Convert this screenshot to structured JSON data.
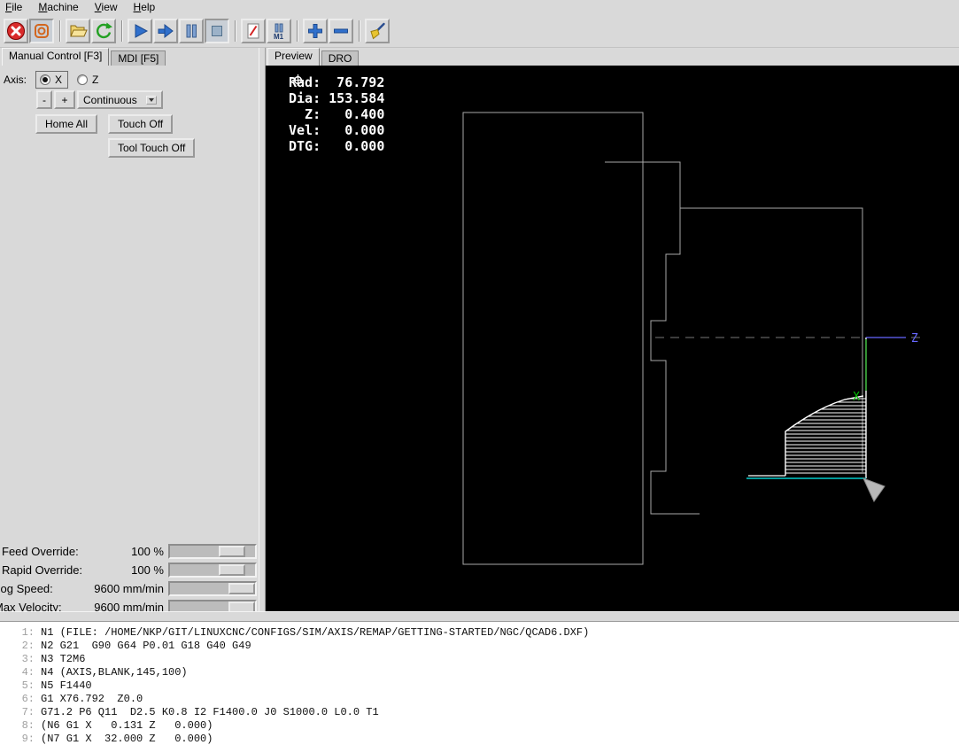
{
  "menu": {
    "items": [
      "File",
      "Machine",
      "View",
      "Help"
    ]
  },
  "toolbar": {
    "optional_pause_label": "M1",
    "buttons": [
      {
        "icon": "estop",
        "pressed": false,
        "sep_after": false
      },
      {
        "icon": "machine-power",
        "pressed": true,
        "sep_after": true
      },
      {
        "icon": "open-file",
        "pressed": false,
        "sep_after": false
      },
      {
        "icon": "reload-file",
        "pressed": false,
        "sep_after": true
      },
      {
        "icon": "run-program",
        "pressed": false,
        "sep_after": false
      },
      {
        "icon": "run-step",
        "pressed": false,
        "sep_after": false
      },
      {
        "icon": "pause-program",
        "pressed": false,
        "sep_after": false
      },
      {
        "icon": "stop-program",
        "pressed": true,
        "sep_after": true
      },
      {
        "icon": "block-delete",
        "pressed": false,
        "sep_after": false
      },
      {
        "icon": "optional-pause",
        "pressed": false,
        "sep_after": true
      },
      {
        "icon": "zoom-in",
        "pressed": false,
        "sep_after": false
      },
      {
        "icon": "zoom-out",
        "pressed": false,
        "sep_after": true
      },
      {
        "icon": "clear-plot",
        "pressed": false,
        "sep_after": false
      }
    ]
  },
  "left_panel": {
    "tabs": [
      {
        "label": "Manual Control [F3]",
        "active": true
      },
      {
        "label": "MDI [F5]",
        "active": false
      }
    ],
    "axis_label": "Axis:",
    "axes": [
      {
        "label": "X",
        "selected": true
      },
      {
        "label": "Z",
        "selected": false
      }
    ],
    "jog_minus": "-",
    "jog_plus": "+",
    "jog_mode": "Continuous",
    "home_all": "Home All",
    "touch_off": "Touch Off",
    "tool_touch_off": "Tool Touch Off",
    "sliders": [
      {
        "label": "Feed Override:",
        "value": "100 %",
        "fraction": 0.83
      },
      {
        "label": "Rapid Override:",
        "value": "100 %",
        "fraction": 0.83
      },
      {
        "label": "Jog Speed:",
        "value": "9600 mm/min",
        "fraction": 1
      },
      {
        "label": "Max Velocity:",
        "value": "9600 mm/min",
        "fraction": 1
      }
    ]
  },
  "preview": {
    "tabs": [
      {
        "label": "Preview",
        "active": true
      },
      {
        "label": "DRO",
        "active": false
      }
    ],
    "dro": [
      {
        "label": "Rad:",
        "value": "76.792",
        "homed": true
      },
      {
        "label": "Dia:",
        "value": "153.584",
        "homed": false
      },
      {
        "label": "Z:",
        "value": "0.400",
        "homed": true
      },
      {
        "label": "Vel:",
        "value": "0.000",
        "homed": false
      },
      {
        "label": "DTG:",
        "value": "0.000",
        "homed": false
      }
    ],
    "axis_labels": {
      "z": "Z",
      "x": "X"
    },
    "colors": {
      "dro_text": "#ffffff",
      "feed_path": "#ffffff",
      "geometry": "#a8a8a8",
      "centerline": "#787878",
      "axis_z": "#6666ff",
      "axis_x": "#00bb00",
      "highlight_path": "#00cccc",
      "tool_marker": "#b8b8b8"
    }
  },
  "gcode": {
    "lines": [
      {
        "no": "1:",
        "text": "N1 (FILE: /HOME/NKP/GIT/LINUXCNC/CONFIGS/SIM/AXIS/REMAP/GETTING-STARTED/NGC/QCAD6.DXF)"
      },
      {
        "no": "2:",
        "text": "N2 G21  G90 G64 P0.01 G18 G40 G49"
      },
      {
        "no": "3:",
        "text": "N3 T2M6"
      },
      {
        "no": "4:",
        "text": "N4 (AXIS,BLANK,145,100)"
      },
      {
        "no": "5:",
        "text": "N5 F1440"
      },
      {
        "no": "6:",
        "text": "G1 X76.792  Z0.0"
      },
      {
        "no": "7:",
        "text": "G71.2 P6 Q11  D2.5 K0.8 I2 F1400.0 J0 S1000.0 L0.0 T1"
      },
      {
        "no": "8:",
        "text": "(N6 G1 X   0.131 Z   0.000)"
      },
      {
        "no": "9:",
        "text": "(N7 G1 X  32.000 Z   0.000)"
      }
    ]
  }
}
